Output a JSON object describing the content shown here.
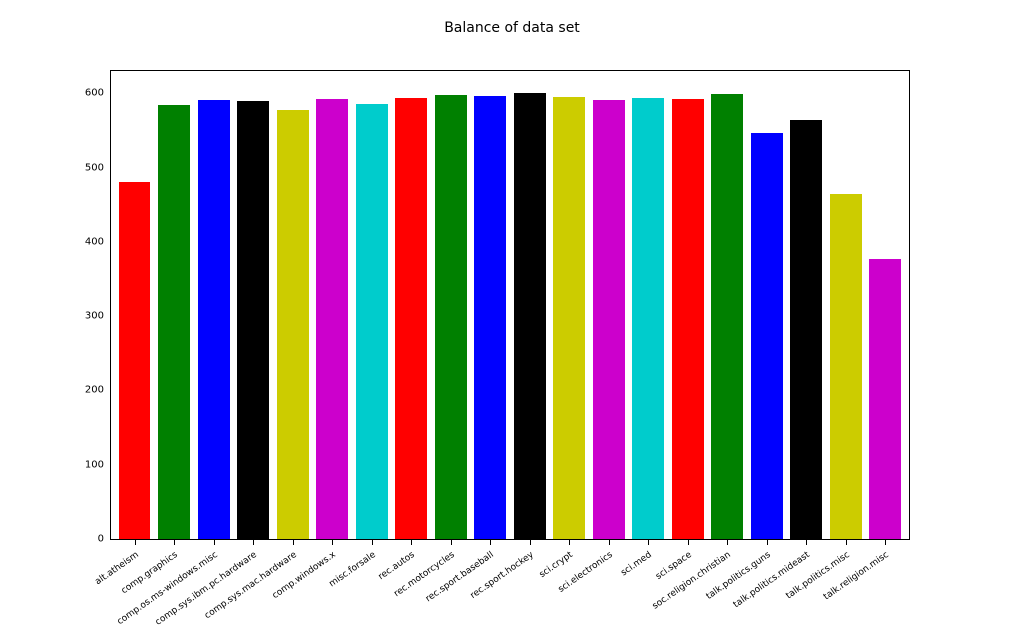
{
  "chart_data": {
    "type": "bar",
    "title": "Balance of data set",
    "xlabel": "",
    "ylabel": "",
    "ylim": [
      0,
      630
    ],
    "yticks": [
      0,
      100,
      200,
      300,
      400,
      500,
      600
    ],
    "categories": [
      "alt.atheism",
      "comp.graphics",
      "comp.os.ms-windows.misc",
      "comp.sys.ibm.pc.hardware",
      "comp.sys.mac.hardware",
      "comp.windows.x",
      "misc.forsale",
      "rec.autos",
      "rec.motorcycles",
      "rec.sport.baseball",
      "rec.sport.hockey",
      "sci.crypt",
      "sci.electronics",
      "sci.med",
      "sci.space",
      "soc.religion.christian",
      "talk.politics.guns",
      "talk.politics.mideast",
      "talk.politics.misc",
      "talk.religion.misc"
    ],
    "values": [
      480,
      584,
      591,
      590,
      578,
      593,
      585,
      594,
      598,
      597,
      600,
      595,
      591,
      594,
      593,
      599,
      546,
      564,
      465,
      377
    ],
    "colors": [
      "#ff0000",
      "#008000",
      "#0000ff",
      "#000000",
      "#cccc00",
      "#cc00cc",
      "#00cccc",
      "#ff0000",
      "#008000",
      "#0000ff",
      "#000000",
      "#cccc00",
      "#cc00cc",
      "#00cccc",
      "#ff0000",
      "#008000",
      "#0000ff",
      "#000000",
      "#cccc00",
      "#cc00cc"
    ],
    "bar_width_ratio": 0.8,
    "xtick_rotation": 35
  }
}
